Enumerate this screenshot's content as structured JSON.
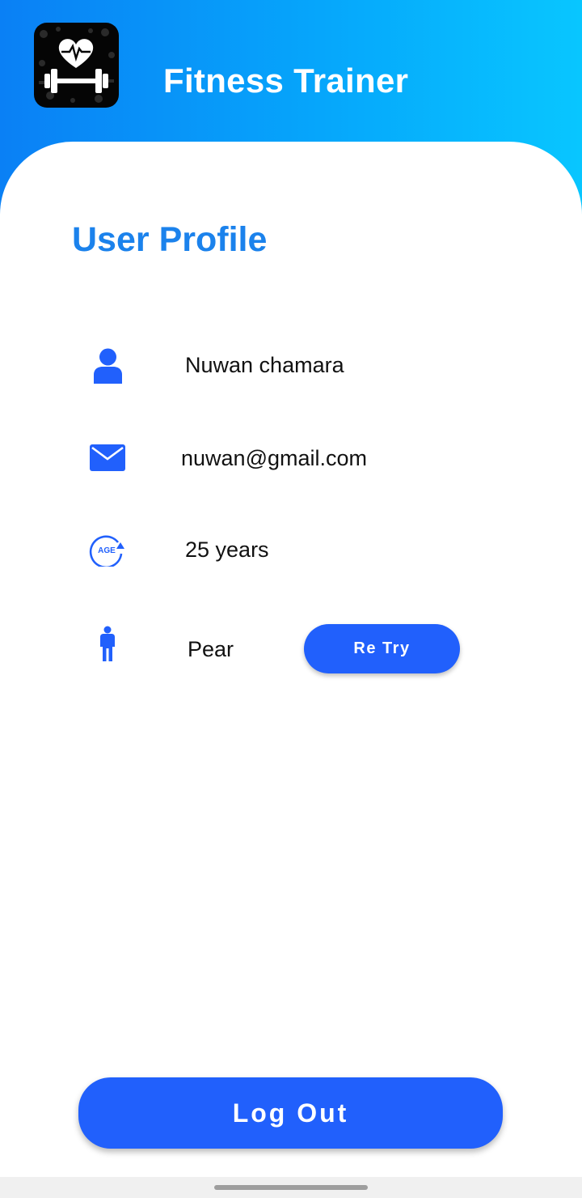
{
  "header": {
    "app_title": "Fitness Trainer",
    "logo_icon": "heart-dumbbell-icon"
  },
  "profile": {
    "title": "User Profile",
    "name": {
      "icon": "person-icon",
      "value": "Nuwan chamara"
    },
    "email": {
      "icon": "mail-icon",
      "value": "nuwan@gmail.com"
    },
    "age": {
      "icon": "age-icon",
      "icon_text": "AGE",
      "value": "25 years"
    },
    "body_type": {
      "icon": "body-figure-icon",
      "value": "Pear"
    },
    "retry_label": "Re Try"
  },
  "footer": {
    "logout_label": "Log Out"
  },
  "colors": {
    "header_gradient_start": "#0a80f5",
    "header_gradient_end": "#08c6ff",
    "title_blue": "#1b82ec",
    "button_blue": "#2160fc",
    "icon_blue": "#2160fc"
  }
}
